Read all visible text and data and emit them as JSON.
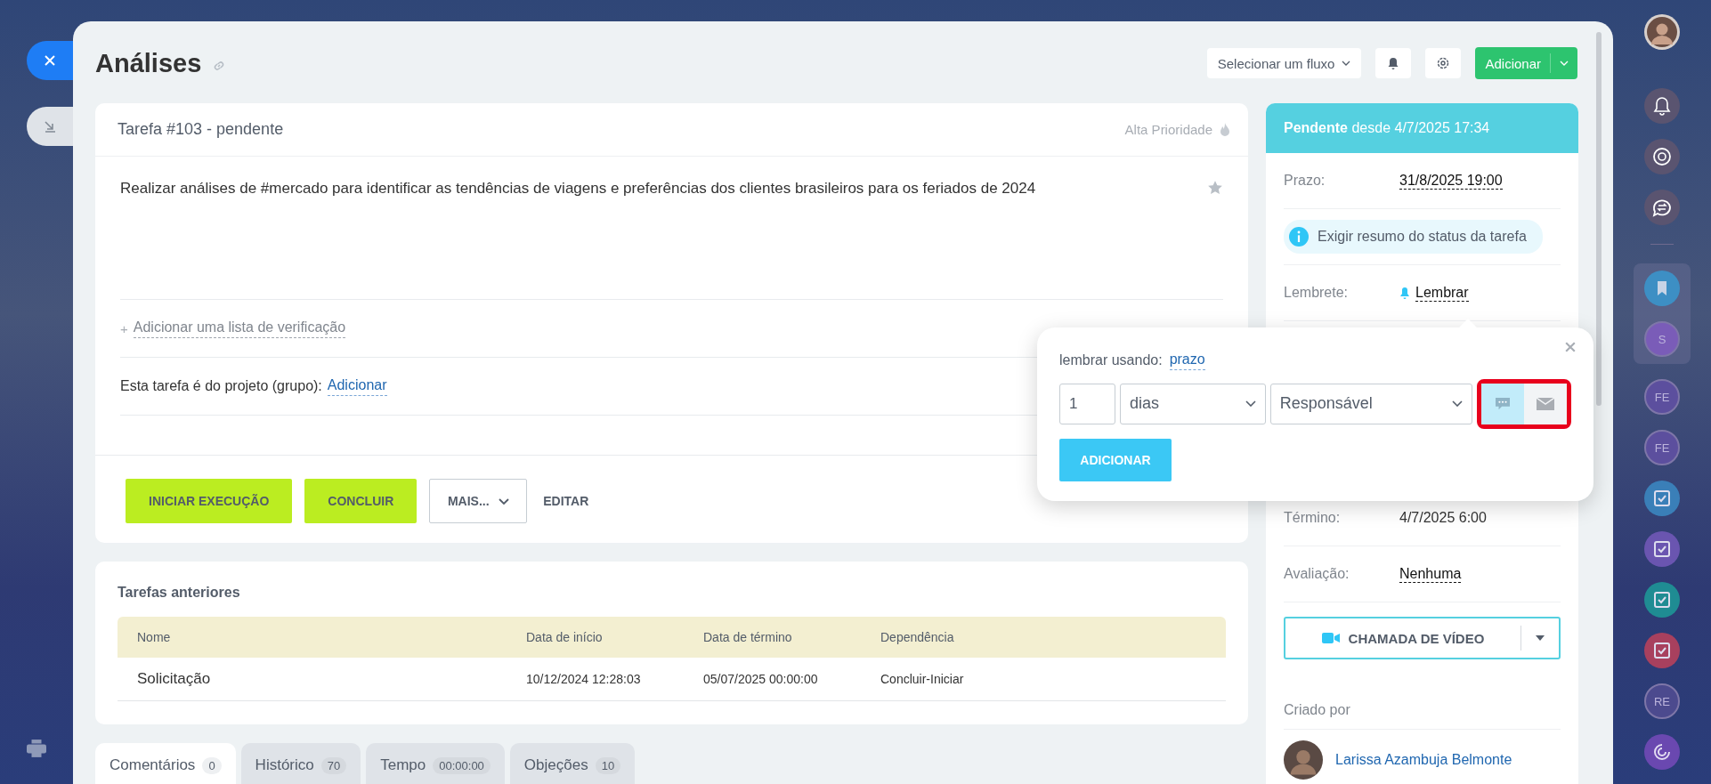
{
  "page": {
    "title": "Análises"
  },
  "header": {
    "flow_select": "Selecionar um fluxo",
    "add_button": "Adicionar"
  },
  "task": {
    "title": "Tarefa #103 - pendente",
    "priority": "Alta Prioridade",
    "starred": false,
    "description": "Realizar análises de #mercado para identificar as tendências de viagens e preferências dos clientes brasileiros para os feriados de 2024",
    "checklist_prefix": "+",
    "checklist_link": "Adicionar uma lista de verificação",
    "project_label": "Esta tarefa é do projeto (grupo):",
    "project_link": "Adicionar",
    "actions": [
      {
        "kind": "primary",
        "label": "INICIAR EXECUÇÃO"
      },
      {
        "kind": "primary",
        "label": "CONCLUIR"
      },
      {
        "kind": "dropdown",
        "label": "MAIS..."
      },
      {
        "kind": "link",
        "label": "EDITAR"
      }
    ]
  },
  "previous_tasks": {
    "title": "Tarefas anteriores",
    "columns": [
      "Nome",
      "Data de início",
      "Data de término",
      "Dependência"
    ],
    "rows": [
      [
        "Solicitação",
        "10/12/2024 12:28:03",
        "05/07/2025 00:00:00",
        "Concluir-Iniciar"
      ]
    ]
  },
  "tabs": [
    {
      "label": "Comentários",
      "count": "0",
      "selected": true
    },
    {
      "label": "Histórico",
      "count": "70",
      "selected": false
    },
    {
      "label": "Tempo",
      "count": "00:00:00",
      "selected": false
    },
    {
      "label": "Objeções",
      "count": "10",
      "selected": false
    }
  ],
  "sidebar": {
    "status": "**Pendente** desde 4/7/2025 17:34",
    "fields": [
      {
        "kind": "editable",
        "label": "Prazo:",
        "value": "31/8/2025 19:00"
      },
      {
        "kind": "notice",
        "text": "Exigir resumo do status da tarefa"
      },
      {
        "kind": "reminder",
        "label": "Lembrete:",
        "value": "Lembrar"
      },
      {
        "kind": "plain",
        "label": "Término:",
        "value": "4/7/2025 6:00"
      },
      {
        "kind": "editable",
        "label": "Avaliação:",
        "value": "Nenhuma"
      }
    ],
    "video_button": "CHAMADA DE VÍDEO",
    "created_by": {
      "label": "Criado por",
      "name": "Larissa Azambuja Belmonte"
    }
  },
  "reminder_popup": {
    "using_label": "lembrar usando:",
    "using_link": "prazo",
    "amount": "1",
    "unit": "dias",
    "recipient": "Responsável",
    "channels": [
      {
        "kind": "message",
        "selected": true
      },
      {
        "kind": "email",
        "selected": false
      }
    ],
    "add_button": "ADICIONAR"
  },
  "right_rail": [
    {
      "kind": "bell"
    },
    {
      "kind": "target"
    },
    {
      "kind": "chat"
    },
    {
      "kind": "bookmark",
      "color": "#3d8fc4"
    },
    {
      "kind": "initials",
      "text": "S",
      "color": "#7a5cb8"
    },
    {
      "kind": "initials",
      "text": "FE",
      "color": "#5c4f9e"
    },
    {
      "kind": "initials",
      "text": "FE",
      "color": "#5c4f9e"
    },
    {
      "kind": "task",
      "color": "#3a7fb8"
    },
    {
      "kind": "task",
      "color": "#6a55b0"
    },
    {
      "kind": "task",
      "color": "#1f8c93"
    },
    {
      "kind": "task",
      "color": "#a8405e"
    },
    {
      "kind": "initials",
      "text": "RE",
      "color": "#4c4a8e"
    },
    {
      "kind": "swirl",
      "color": "#6a48b0"
    }
  ]
}
